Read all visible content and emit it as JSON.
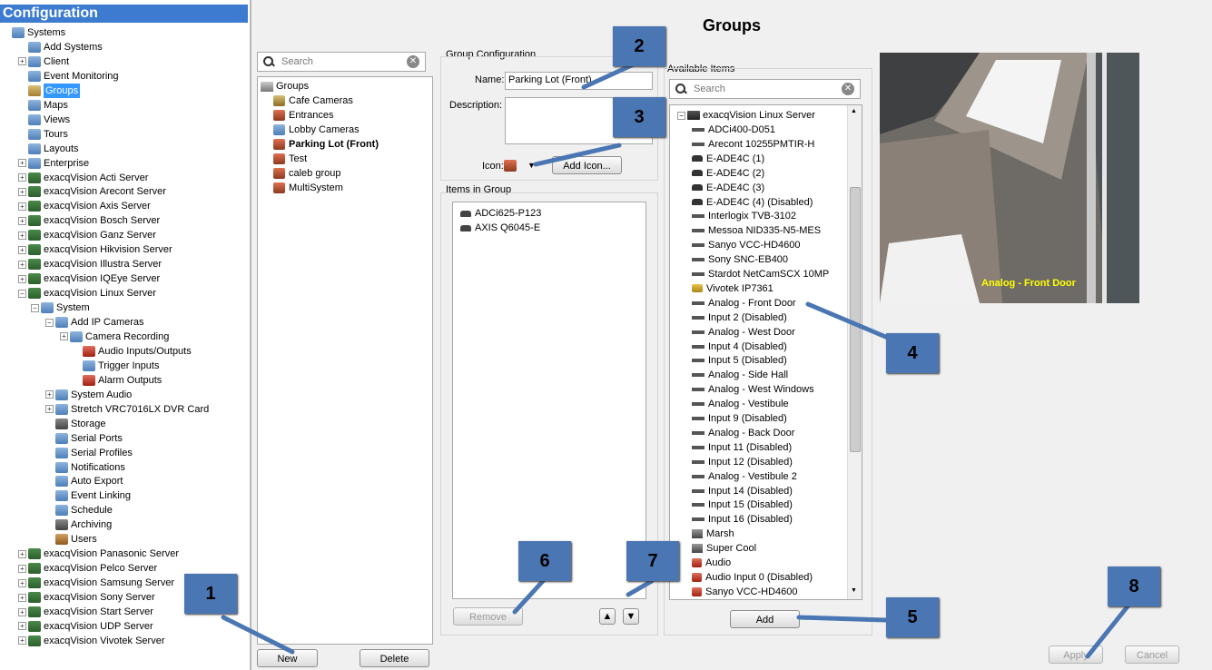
{
  "left": {
    "header": "Configuration",
    "tree": [
      {
        "label": "Systems",
        "x": 2,
        "icon": "systems-icon",
        "exp": ""
      },
      {
        "label": "Add Systems",
        "x": 20,
        "icon": "add-systems-icon",
        "exp": ""
      },
      {
        "label": "Client",
        "x": 20,
        "icon": "client-icon",
        "exp": "+"
      },
      {
        "label": "Event Monitoring",
        "x": 20,
        "icon": "event-monitoring-icon",
        "exp": ""
      },
      {
        "label": "Groups",
        "x": 20,
        "icon": "groups-icon",
        "exp": "",
        "selected": true
      },
      {
        "label": "Maps",
        "x": 20,
        "icon": "maps-icon",
        "exp": ""
      },
      {
        "label": "Views",
        "x": 20,
        "icon": "views-icon",
        "exp": ""
      },
      {
        "label": "Tours",
        "x": 20,
        "icon": "tours-icon",
        "exp": ""
      },
      {
        "label": "Layouts",
        "x": 20,
        "icon": "layouts-icon",
        "exp": ""
      },
      {
        "label": "Enterprise",
        "x": 20,
        "icon": "enterprise-icon",
        "exp": "+"
      },
      {
        "label": "exacqVision Acti Server",
        "x": 20,
        "icon": "server-icon",
        "exp": "+"
      },
      {
        "label": "exacqVision Arecont Server",
        "x": 20,
        "icon": "server-icon",
        "exp": "+"
      },
      {
        "label": "exacqVision Axis Server",
        "x": 20,
        "icon": "server-icon",
        "exp": "+"
      },
      {
        "label": "exacqVision Bosch Server",
        "x": 20,
        "icon": "server-icon",
        "exp": "+"
      },
      {
        "label": "exacqVision Ganz Server",
        "x": 20,
        "icon": "server-icon",
        "exp": "+"
      },
      {
        "label": "exacqVision Hikvision Server",
        "x": 20,
        "icon": "server-icon",
        "exp": "+"
      },
      {
        "label": "exacqVision Illustra Server",
        "x": 20,
        "icon": "server-icon",
        "exp": "+"
      },
      {
        "label": "exacqVision IQEye Server",
        "x": 20,
        "icon": "server-icon",
        "exp": "+"
      },
      {
        "label": "exacqVision Linux Server",
        "x": 20,
        "icon": "server-icon",
        "exp": "−"
      },
      {
        "label": "System",
        "x": 34,
        "icon": "system-icon",
        "exp": "−"
      },
      {
        "label": "Add IP Cameras",
        "x": 50,
        "icon": "add-ip-cameras-icon",
        "exp": "−"
      },
      {
        "label": "Camera Recording",
        "x": 66,
        "icon": "camera-recording-icon",
        "exp": "+"
      },
      {
        "label": "Audio Inputs/Outputs",
        "x": 80,
        "icon": "audio-icon",
        "exp": ""
      },
      {
        "label": "Trigger Inputs",
        "x": 80,
        "icon": "trigger-inputs-icon",
        "exp": ""
      },
      {
        "label": "Alarm Outputs",
        "x": 80,
        "icon": "alarm-outputs-icon",
        "exp": ""
      },
      {
        "label": "System Audio",
        "x": 50,
        "icon": "system-audio-icon",
        "exp": "+"
      },
      {
        "label": "Stretch VRC7016LX DVR Card",
        "x": 50,
        "icon": "dvr-card-icon",
        "exp": "+"
      },
      {
        "label": "Storage",
        "x": 50,
        "icon": "storage-icon",
        "exp": ""
      },
      {
        "label": "Serial Ports",
        "x": 50,
        "icon": "serial-ports-icon",
        "exp": ""
      },
      {
        "label": "Serial Profiles",
        "x": 50,
        "icon": "serial-profiles-icon",
        "exp": ""
      },
      {
        "label": "Notifications",
        "x": 50,
        "icon": "notifications-icon",
        "exp": ""
      },
      {
        "label": "Auto Export",
        "x": 50,
        "icon": "auto-export-icon",
        "exp": ""
      },
      {
        "label": "Event Linking",
        "x": 50,
        "icon": "event-linking-icon",
        "exp": ""
      },
      {
        "label": "Schedule",
        "x": 50,
        "icon": "schedule-icon",
        "exp": ""
      },
      {
        "label": "Archiving",
        "x": 50,
        "icon": "archiving-icon",
        "exp": ""
      },
      {
        "label": "Users",
        "x": 50,
        "icon": "users-icon",
        "exp": ""
      },
      {
        "label": "exacqVision Panasonic Server",
        "x": 20,
        "icon": "server-icon",
        "exp": "+"
      },
      {
        "label": "exacqVision Pelco Server",
        "x": 20,
        "icon": "server-icon",
        "exp": "+"
      },
      {
        "label": "exacqVision Samsung Server",
        "x": 20,
        "icon": "server-icon",
        "exp": "+"
      },
      {
        "label": "exacqVision Sony Server",
        "x": 20,
        "icon": "server-icon",
        "exp": "+"
      },
      {
        "label": "exacqVision Start Server",
        "x": 20,
        "icon": "server-icon",
        "exp": "+"
      },
      {
        "label": "exacqVision UDP Server",
        "x": 20,
        "icon": "server-icon",
        "exp": "+"
      },
      {
        "label": "exacqVision Vivotek Server",
        "x": 20,
        "icon": "server-icon",
        "exp": "+"
      }
    ]
  },
  "main": {
    "title": "Groups",
    "groups_search_placeholder": "Search",
    "groups_root": "Groups",
    "groups": [
      "Cafe Cameras",
      "Entrances",
      "Lobby Cameras",
      "Parking Lot (Front)",
      "Test",
      "caleb group",
      "MultiSystem"
    ],
    "selected_group": "Parking Lot (Front)",
    "new_label": "New",
    "delete_label": "Delete",
    "group_config_label": "Group Configuration",
    "name_label": "Name:",
    "name_value": "Parking Lot (Front)",
    "description_label": "Description:",
    "icon_label": "Icon:",
    "add_icon_label": "Add Icon...",
    "items_in_group_label": "Items in Group",
    "items_in_group": [
      "ADCi625-P123",
      "AXIS Q6045-E"
    ],
    "remove_label": "Remove",
    "available_items_label": "Available Items",
    "available_search_placeholder": "Search",
    "available_root": "exacqVision Linux Server",
    "available_items": [
      "ADCi400-D051",
      "Arecont 10255PMTIR-H",
      "E-ADE4C (1)",
      "E-ADE4C (2)",
      "E-ADE4C (3)",
      "E-ADE4C (4) (Disabled)",
      "Interlogix TVB-3102",
      "Messoa NID335-N5-MES",
      "Sanyo VCC-HD4600",
      "Sony SNC-EB400",
      "Stardot NetCamSCX 10MP",
      "Vivotek IP7361",
      "Analog - Front Door",
      "Input 2 (Disabled)",
      "Analog - West Door",
      "Input 4 (Disabled)",
      "Input 5 (Disabled)",
      "Analog - Side Hall",
      "Analog - West Windows",
      "Analog - Vestibule",
      "Input 9 (Disabled)",
      "Analog - Back Door",
      "Input 11 (Disabled)",
      "Input 12 (Disabled)",
      "Analog - Vestibule 2",
      "Input 14 (Disabled)",
      "Input 15 (Disabled)",
      "Input 16 (Disabled)",
      "Marsh",
      "Super Cool",
      "Audio",
      "Audio Input 0 (Disabled)",
      "Sanyo VCC-HD4600"
    ],
    "add_label": "Add",
    "video_caption": "Analog - Front Door",
    "apply_label": "Apply",
    "cancel_label": "Cancel"
  },
  "callouts": [
    "1",
    "2",
    "3",
    "4",
    "5",
    "6",
    "7",
    "8"
  ],
  "colors": {
    "header_bg": "#3c7bd0",
    "callout": "#4a76b3",
    "selection": "#3399ff",
    "video_caption": "#ffff00"
  }
}
